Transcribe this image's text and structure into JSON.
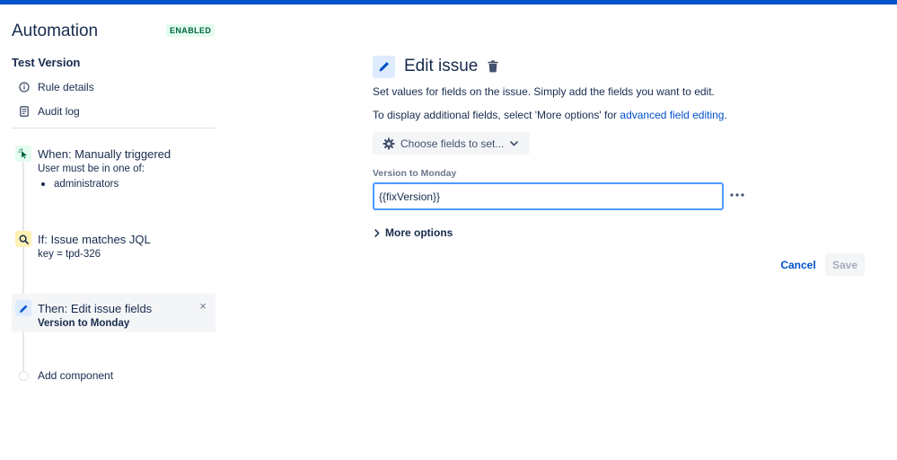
{
  "app": {
    "title": "Automation",
    "status": "ENABLED",
    "rule_name": "Test Version"
  },
  "nav": {
    "items": [
      {
        "label": "Rule details",
        "icon": "info-icon"
      },
      {
        "label": "Audit log",
        "icon": "document-icon"
      }
    ]
  },
  "steps": {
    "trigger": {
      "title": "When: Manually triggered",
      "line1": "User must be in one of:",
      "bullet": "administrators",
      "icon": "cursor-click-icon"
    },
    "condition": {
      "title": "If: Issue matches JQL",
      "line1": "key = tpd-326",
      "icon": "search-icon"
    },
    "action": {
      "title": "Then: Edit issue fields",
      "line1": "Version to Monday",
      "icon": "pencil-icon",
      "close": "×"
    },
    "add_component": "Add component"
  },
  "editor": {
    "title": "Edit issue",
    "desc1": "Set values for fields on the issue. Simply add the fields you want to edit.",
    "desc2_prefix": "To display additional fields, select 'More options' for ",
    "desc2_link": "advanced field editing",
    "desc2_suffix": ".",
    "choose_fields": "Choose fields to set...",
    "field_label": "Version to Monday",
    "field_value": "{{fixVersion}}",
    "more_options": "More options",
    "cancel": "Cancel",
    "save": "Save"
  },
  "colors": {
    "brand": "#0052cc",
    "focus_border": "#4c9aff",
    "enabled_bg": "#e3fcef",
    "enabled_text": "#006644"
  }
}
